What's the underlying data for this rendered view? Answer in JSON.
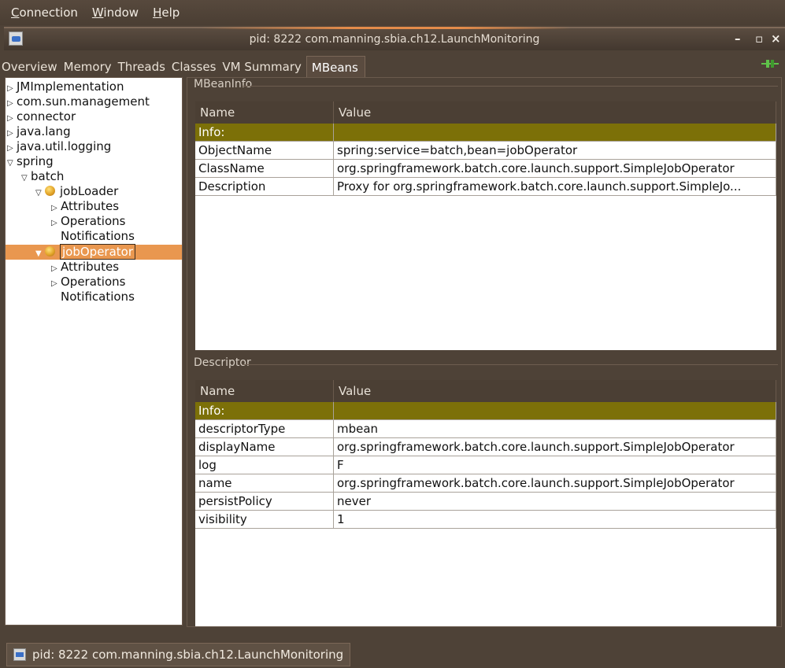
{
  "menu": {
    "items": [
      "Connection",
      "Window",
      "Help"
    ]
  },
  "window": {
    "title": "pid: 8222 com.manning.sbia.ch12.LaunchMonitoring",
    "min": "–",
    "max": "▫",
    "close": "×"
  },
  "tabs": [
    "Overview",
    "Memory",
    "Threads",
    "Classes",
    "VM Summary",
    "MBeans"
  ],
  "active_tab": "MBeans",
  "tree": {
    "n0": "JMImplementation",
    "n1": "com.sun.management",
    "n2": "connector",
    "n3": "java.lang",
    "n4": "java.util.logging",
    "n5": "spring",
    "n6": "batch",
    "n7": "jobLoader",
    "n8": "Attributes",
    "n9": "Operations",
    "n10": "Notifications",
    "n11": "jobOperator",
    "n12": "Attributes",
    "n13": "Operations",
    "n14": "Notifications"
  },
  "mbeaninfo": {
    "title": "MBeanInfo",
    "col_name": "Name",
    "col_value": "Value",
    "rows": [
      {
        "name": "Info:",
        "value": ""
      },
      {
        "name": "ObjectName",
        "value": "spring:service=batch,bean=jobOperator"
      },
      {
        "name": "ClassName",
        "value": "org.springframework.batch.core.launch.support.SimpleJobOperator"
      },
      {
        "name": "Description",
        "value": "Proxy for org.springframework.batch.core.launch.support.SimpleJo..."
      }
    ]
  },
  "descriptor": {
    "title": "Descriptor",
    "col_name": "Name",
    "col_value": "Value",
    "rows": [
      {
        "name": "Info:",
        "value": ""
      },
      {
        "name": "descriptorType",
        "value": "mbean"
      },
      {
        "name": "displayName",
        "value": "org.springframework.batch.core.launch.support.SimpleJobOperator"
      },
      {
        "name": "log",
        "value": "F"
      },
      {
        "name": "name",
        "value": "org.springframework.batch.core.launch.support.SimpleJobOperator"
      },
      {
        "name": "persistPolicy",
        "value": "never"
      },
      {
        "name": "visibility",
        "value": "1"
      }
    ]
  },
  "taskbar": {
    "label": "pid: 8222 com.manning.sbia.ch12.LaunchMonitoring"
  },
  "colors": {
    "info_row": "#7c7008",
    "selection": "#e9974f",
    "chrome": "#4e4237"
  }
}
